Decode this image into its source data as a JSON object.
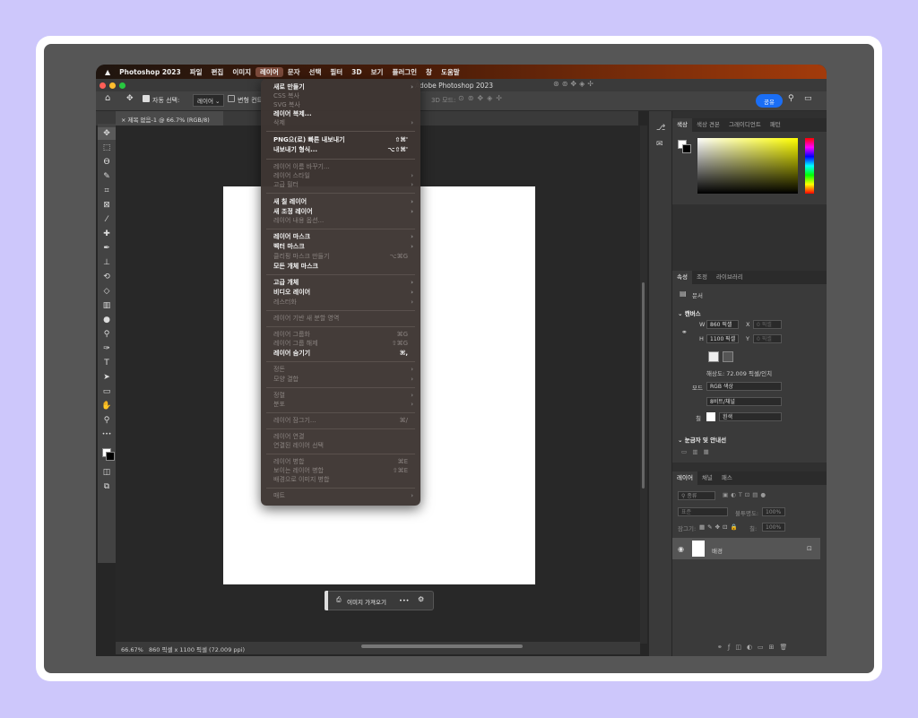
{
  "menubar": {
    "apple": "",
    "items": [
      {
        "label": "Photoshop 2023",
        "active": false
      },
      {
        "label": "파일",
        "active": false
      },
      {
        "label": "편집",
        "active": false
      },
      {
        "label": "이미지",
        "active": false
      },
      {
        "label": "레이어",
        "active": true
      },
      {
        "label": "문자",
        "active": false
      },
      {
        "label": "선택",
        "active": false
      },
      {
        "label": "필터",
        "active": false
      },
      {
        "label": "3D",
        "active": false
      },
      {
        "label": "보기",
        "active": false
      },
      {
        "label": "플러그인",
        "active": false
      },
      {
        "label": "창",
        "active": false
      },
      {
        "label": "도움말",
        "active": false
      }
    ]
  },
  "window": {
    "title": "Adobe Photoshop 2023",
    "traffic_colors": [
      "#fe5f57",
      "#febc2e",
      "#28c840"
    ]
  },
  "options_bar": {
    "auto_select_label": "자동 선택:",
    "auto_select_value": "레이어",
    "transform_label": "변형 컨트",
    "mode_3d": "3D 모드:",
    "share_label": "공유"
  },
  "document": {
    "tab_label": "제목 없음-1 @ 66.7% (RGB/8)",
    "tab_close": "×"
  },
  "taskbar": {
    "import_label": "이미지 가져오기",
    "more": "•••"
  },
  "status": {
    "zoom": "66.67%",
    "info": "860 픽셀 x 1100 픽셀 (72.009 ppi)"
  },
  "color_panel": {
    "tabs": [
      "색상",
      "색상 견본",
      "그레이디언트",
      "패턴"
    ],
    "hue_colors": [
      "#ff0000",
      "#ff00ff",
      "#0000ff",
      "#00ffff",
      "#00ff00",
      "#ffff00",
      "#ff0000"
    ]
  },
  "properties_panel": {
    "tabs": [
      "속성",
      "조정",
      "라이브러리"
    ],
    "doc_label": "문서",
    "canvas_header": "캔버스",
    "w_label": "W",
    "w_value": "860 픽셀",
    "x_label": "X",
    "x_placeholder": "0 픽셀",
    "h_label": "H",
    "h_value": "1100 픽셀",
    "y_label": "Y",
    "y_placeholder": "0 픽셀",
    "resolution": "해상도: 72.009 픽셀/인치",
    "mode_label": "모드",
    "mode_value": "RGB 색상",
    "bit_value": "8비트/채널",
    "fill_label": "칠",
    "fill_value": "흰색",
    "rulers_header": "눈금자 및 안내선"
  },
  "layers_panel": {
    "tabs": [
      "레이어",
      "채널",
      "패스"
    ],
    "kind_filter": "종류",
    "blend_mode": "표준",
    "opacity_label": "불투명도:",
    "opacity_value": "100%",
    "lock_label": "잠그기:",
    "fill_label": "칠:",
    "fill_value": "100%",
    "layer_name": "배경"
  },
  "layer_menu": {
    "items": [
      {
        "label": "새로 만들기",
        "shortcut": "",
        "submenu": true,
        "enabled": true
      },
      {
        "label": "CSS 복사",
        "shortcut": "",
        "submenu": false,
        "enabled": false
      },
      {
        "label": "SVG 복사",
        "shortcut": "",
        "submenu": false,
        "enabled": false
      },
      {
        "label": "레이어 복제...",
        "shortcut": "",
        "submenu": false,
        "enabled": true
      },
      {
        "label": "삭제",
        "shortcut": "",
        "submenu": true,
        "enabled": false
      },
      {
        "label": "PNG으(로) 빠른 내보내기",
        "shortcut": "⇧⌘'",
        "submenu": false,
        "enabled": true
      },
      {
        "label": "내보내기 형식...",
        "shortcut": "⌥⇧⌘'",
        "submenu": false,
        "enabled": true
      },
      {
        "label": "레이어 이름 바꾸기...",
        "shortcut": "",
        "submenu": false,
        "enabled": false
      },
      {
        "label": "레이어 스타일",
        "shortcut": "",
        "submenu": true,
        "enabled": false
      },
      {
        "label": "고급 필터",
        "shortcut": "",
        "submenu": true,
        "enabled": false
      },
      {
        "label": "새 칠 레이어",
        "shortcut": "",
        "submenu": true,
        "enabled": true
      },
      {
        "label": "새 조정 레이어",
        "shortcut": "",
        "submenu": true,
        "enabled": true
      },
      {
        "label": "레이어 내용 옵션...",
        "shortcut": "",
        "submenu": false,
        "enabled": false
      },
      {
        "label": "레이어 마스크",
        "shortcut": "",
        "submenu": true,
        "enabled": true
      },
      {
        "label": "벡터 마스크",
        "shortcut": "",
        "submenu": true,
        "enabled": true
      },
      {
        "label": "클리핑 마스크 만들기",
        "shortcut": "⌥⌘G",
        "submenu": false,
        "enabled": false
      },
      {
        "label": "모든 개체 마스크",
        "shortcut": "",
        "submenu": false,
        "enabled": true
      },
      {
        "label": "고급 개체",
        "shortcut": "",
        "submenu": true,
        "enabled": true
      },
      {
        "label": "비디오 레이어",
        "shortcut": "",
        "submenu": true,
        "enabled": true
      },
      {
        "label": "레스터화",
        "shortcut": "",
        "submenu": true,
        "enabled": false
      },
      {
        "label": "레이어 기반 새 분할 영역",
        "shortcut": "",
        "submenu": false,
        "enabled": false
      },
      {
        "label": "레이어 그룹화",
        "shortcut": "⌘G",
        "submenu": false,
        "enabled": false
      },
      {
        "label": "레이어 그룹 해제",
        "shortcut": "⇧⌘G",
        "submenu": false,
        "enabled": false
      },
      {
        "label": "레이어 숨기기",
        "shortcut": "⌘,",
        "submenu": false,
        "enabled": true
      },
      {
        "label": "정돈",
        "shortcut": "",
        "submenu": true,
        "enabled": false
      },
      {
        "label": "모양 결합",
        "shortcut": "",
        "submenu": true,
        "enabled": false
      },
      {
        "label": "정렬",
        "shortcut": "",
        "submenu": true,
        "enabled": false
      },
      {
        "label": "분포",
        "shortcut": "",
        "submenu": true,
        "enabled": false
      },
      {
        "label": "레이어 잠그기...",
        "shortcut": "⌘/",
        "submenu": false,
        "enabled": false
      },
      {
        "label": "레이어 연결",
        "shortcut": "",
        "submenu": false,
        "enabled": false
      },
      {
        "label": "연결된 레이어 선택",
        "shortcut": "",
        "submenu": false,
        "enabled": false
      },
      {
        "label": "레이어 병합",
        "shortcut": "⌘E",
        "submenu": false,
        "enabled": false
      },
      {
        "label": "보이는 레이어 병합",
        "shortcut": "⇧⌘E",
        "submenu": false,
        "enabled": false
      },
      {
        "label": "배경으로 이미지 병합",
        "shortcut": "",
        "submenu": false,
        "enabled": false
      },
      {
        "label": "매트",
        "shortcut": "",
        "submenu": true,
        "enabled": false
      }
    ],
    "arrow": "›"
  },
  "tools": [
    {
      "name": "move-tool-icon",
      "glyph": "✥"
    },
    {
      "name": "marquee-tool-icon",
      "glyph": "⬚"
    },
    {
      "name": "lasso-tool-icon",
      "glyph": "ϴ"
    },
    {
      "name": "quick-select-tool-icon",
      "glyph": "✎"
    },
    {
      "name": "crop-tool-icon",
      "glyph": "⌗"
    },
    {
      "name": "frame-tool-icon",
      "glyph": "⊠"
    },
    {
      "name": "eyedropper-tool-icon",
      "glyph": "⁄"
    },
    {
      "name": "healing-tool-icon",
      "glyph": "✚"
    },
    {
      "name": "brush-tool-icon",
      "glyph": "✒"
    },
    {
      "name": "stamp-tool-icon",
      "glyph": "⊥"
    },
    {
      "name": "history-brush-tool-icon",
      "glyph": "⟲"
    },
    {
      "name": "eraser-tool-icon",
      "glyph": "◇"
    },
    {
      "name": "gradient-tool-icon",
      "glyph": "▥"
    },
    {
      "name": "blur-tool-icon",
      "glyph": "●"
    },
    {
      "name": "dodge-tool-icon",
      "glyph": "⚲"
    },
    {
      "name": "pen-tool-icon",
      "glyph": "✑"
    },
    {
      "name": "type-tool-icon",
      "glyph": "T"
    },
    {
      "name": "path-select-tool-icon",
      "glyph": "➤"
    },
    {
      "name": "rectangle-tool-icon",
      "glyph": "▭"
    },
    {
      "name": "hand-tool-icon",
      "glyph": "✋"
    },
    {
      "name": "zoom-tool-icon",
      "glyph": "⚲"
    },
    {
      "name": "more-tools-icon",
      "glyph": "•••"
    }
  ]
}
